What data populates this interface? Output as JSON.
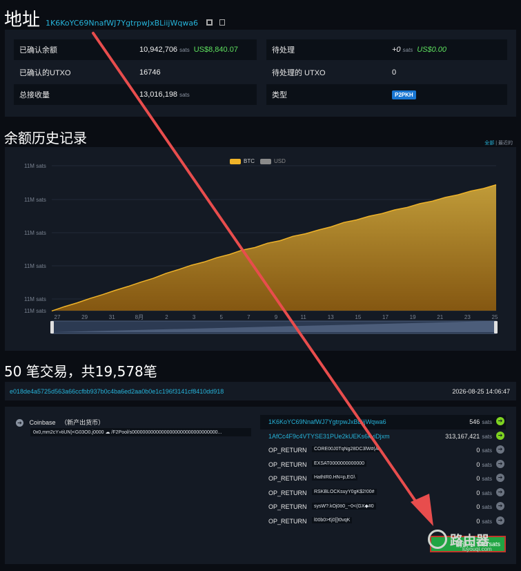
{
  "address": {
    "title": "地址",
    "hash": "1K6KoYC69NnafWJ7YgtrpwJxBLiijWqwa6"
  },
  "summary": {
    "rows": [
      {
        "label": "已确认余额",
        "value": "10,942,706",
        "unit": "sats",
        "usd": "US$8,840.07"
      },
      {
        "label": "已确认的UTXO",
        "value": "16746"
      },
      {
        "label": "总接收量",
        "value": "13,016,198",
        "unit": "sats"
      }
    ],
    "pending": [
      {
        "label": "待处理",
        "value": "+0",
        "unit": "sats",
        "usd": "US$0.00"
      },
      {
        "label": "待处理的 UTXO",
        "value": "0"
      },
      {
        "label": "类型",
        "badge": "P2PKH"
      }
    ]
  },
  "history": {
    "title": "余额历史记录",
    "range_all": "全部",
    "range_sep": "|",
    "range_recent": "最近的"
  },
  "chart_data": {
    "type": "area",
    "legend": [
      {
        "name": "BTC",
        "color": "#f0b429",
        "active": true
      },
      {
        "name": "USD",
        "color": "#8a8a8a",
        "active": false
      }
    ],
    "y_tick_labels": [
      "11M sats",
      "11M sats",
      "11M sats",
      "11M sats",
      "11M sats",
      "11M sats"
    ],
    "x_tick_labels": [
      "27",
      "29",
      "31",
      "8月",
      "2",
      "3",
      "5",
      "7",
      "9",
      "11",
      "13",
      "15",
      "17",
      "19",
      "21",
      "23",
      "25"
    ],
    "series": [
      {
        "name": "BTC",
        "color": "#f0b429",
        "values": [
          0,
          3,
          6.5,
          9.5,
          13,
          16,
          19.5,
          22.5,
          26,
          29.5,
          33,
          36,
          39,
          42,
          45,
          48,
          50.5,
          53.5,
          56,
          59,
          61.5,
          64,
          67,
          70,
          72.5,
          75,
          77.5,
          80,
          82.5,
          85,
          87.5,
          90,
          92.5,
          95,
          97.5,
          100
        ]
      }
    ],
    "grid": true
  },
  "transactions": {
    "title": "50 笔交易，共19,578笔",
    "tx": {
      "hash": "e018de4a5725d563a66ccfbb937b0c4ba6ed2aa0b0e1c196f3141cf8410dd918",
      "time": "2026-08-25 14:06:47",
      "input": {
        "label": "Coinbase",
        "tag": "（新产出货币）",
        "data": "0x0,mm2cY»tiUN)<G03O0.j0000 ☁ /F2Pool/s00000000000000000000000000000000..."
      },
      "outputs": [
        {
          "addr": "1K6KoYC69NnafWJ7YgtrpwJxBLiijWqwa6",
          "value": "546",
          "unit": "sats",
          "state": "unspent",
          "highlight": true,
          "link": true
        },
        {
          "addr": "1AfCc4F9c4VTYSE31PUe2kUEKs6kviDjxm",
          "value": "313,167,421",
          "unit": "sats",
          "state": "unspent",
          "link": true
        },
        {
          "addr": "OP_RETURN",
          "data": "CORE00J0TqNg28DC3lW#(A",
          "value": "0",
          "unit": "sats",
          "state": "spent"
        },
        {
          "addr": "OP_RETURN",
          "data": "EXSAT0000000000000",
          "value": "0",
          "unit": "sats",
          "state": "spent"
        },
        {
          "addr": "OP_RETURN",
          "data": "HathIR0.HN=p,EG\\",
          "value": "0",
          "unit": "sats",
          "state": "spent"
        },
        {
          "addr": "OP_RETURN",
          "data": "RSKBLOCKsuyY0gK$2!00#",
          "value": "0",
          "unit": "sats",
          "state": "spent"
        },
        {
          "addr": "OP_RETURN",
          "data": "sysW?.kOj0ö0_~0<(GX◆#0",
          "value": "0",
          "unit": "sats",
          "state": "spent"
        },
        {
          "addr": "OP_RETURN",
          "data": "l00b0>€j0[[t0vqK",
          "value": "0",
          "unit": "sats",
          "state": "spent"
        }
      ],
      "confirm_label": "确认 1",
      "total": "546 sats"
    }
  },
  "watermark": {
    "text": "路由器",
    "url": "luyouqi.com"
  },
  "colors": {
    "accent": "#26b3d9",
    "usd": "#5ee05e",
    "chart_fill": "#b8860b",
    "arrow": "#e84d4d"
  }
}
